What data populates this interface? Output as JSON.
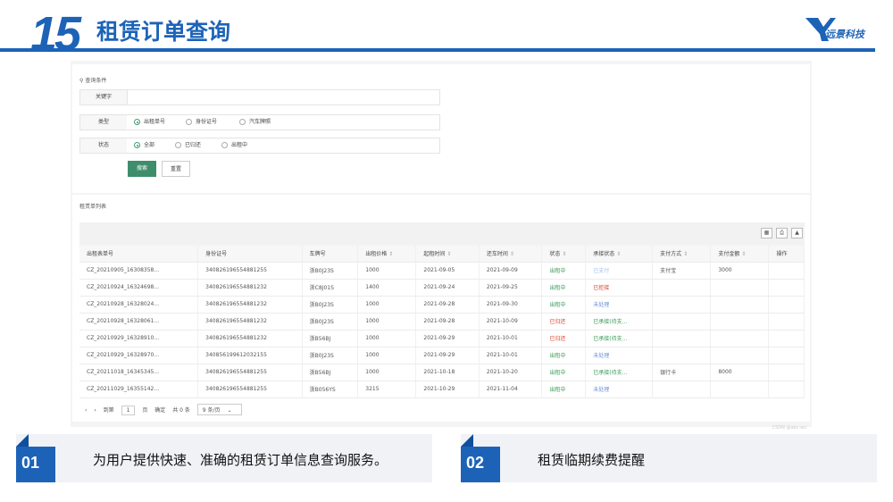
{
  "header": {
    "number": "15",
    "title": "租赁订单查询",
    "brand": "远景科技",
    "accent_color": "#1c63b8"
  },
  "query": {
    "section_title": "查询条件",
    "keyword_label": "关键字",
    "keyword_value": "",
    "type_label": "类型",
    "type_options": [
      "出租单号",
      "身份证号",
      "汽车牌照"
    ],
    "type_selected": "出租单号",
    "status_label": "状态",
    "status_options": [
      "全部",
      "已归还",
      "出租中"
    ],
    "status_selected": "全部",
    "search_button": "搜索",
    "reset_button": "重置"
  },
  "list": {
    "section_title": "租赁单列表",
    "columns": [
      "出租表单号",
      "身份证号",
      "车牌号",
      "出租价格",
      "起租时间",
      "还车时间",
      "状态",
      "承接状态",
      "支付方式",
      "支付金额",
      "操作"
    ],
    "rows": [
      [
        "CZ_20210905_16308358...",
        "340826196554881255",
        "浙B0J23S",
        "1000",
        "2021-09-05",
        "2021-09-09",
        "出租中",
        "已支付",
        "支付宝",
        "3000",
        ""
      ],
      [
        "CZ_20210924_16324698...",
        "340826196554881232",
        "浙C8J01S",
        "1400",
        "2021-09-24",
        "2021-09-25",
        "出租中",
        "已拒接",
        "",
        "",
        ""
      ],
      [
        "CZ_20210928_16328024...",
        "340826196554881232",
        "浙B0J23S",
        "1000",
        "2021-09-28",
        "2021-09-30",
        "出租中",
        "未处理",
        "",
        "",
        ""
      ],
      [
        "CZ_20210928_16328061...",
        "340826196554881232",
        "浙B0J23S",
        "1000",
        "2021-09-28",
        "2021-10-09",
        "已归还",
        "已承接(待支...",
        "",
        "",
        ""
      ],
      [
        "CZ_20210929_16328910...",
        "340826196554881232",
        "浙B56BJ",
        "1000",
        "2021-09-29",
        "2021-10-01",
        "已归还",
        "已承接(待支...",
        "",
        "",
        ""
      ],
      [
        "CZ_20210929_16328970...",
        "340856199612032155",
        "浙B0J23S",
        "1000",
        "2021-09-29",
        "2021-10-01",
        "出租中",
        "未处理",
        "",
        "",
        ""
      ],
      [
        "CZ_20211018_16345345...",
        "340826196554881255",
        "浙B56BJ",
        "1000",
        "2021-10-18",
        "2021-10-20",
        "出租中",
        "已承接(待支...",
        "银行卡",
        "8000",
        ""
      ],
      [
        "CZ_20211029_16355142...",
        "340826196554881255",
        "浙B056YS",
        "3215",
        "2021-10-29",
        "2021-11-04",
        "出租中",
        "未处理",
        "",
        "",
        ""
      ]
    ],
    "pager": {
      "goto_label": "到第",
      "page_value": "1",
      "page_unit": "页",
      "confirm": "确定",
      "total": "共 0 条",
      "page_size": "9 条/页"
    },
    "watermark": "CSDN @abc-wz"
  },
  "features": [
    {
      "num": "01",
      "text": "为用户提供快速、准确的租赁订单信息查询服务。"
    },
    {
      "num": "02",
      "text": "租赁临期续费提醒"
    }
  ]
}
